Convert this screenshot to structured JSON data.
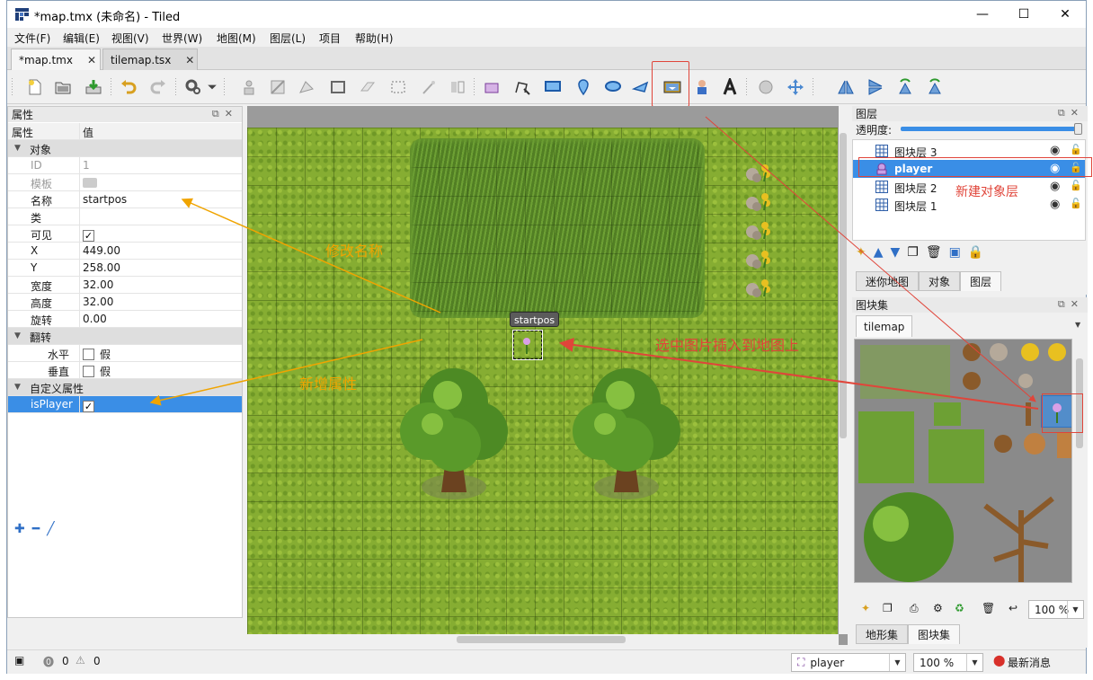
{
  "window": {
    "title": "*map.tmx (未命名) - Tiled",
    "controls": {
      "minimize": "—",
      "maximize": "☐",
      "close": "✕"
    }
  },
  "menu": [
    "文件(F)",
    "编辑(E)",
    "视图(V)",
    "世界(W)",
    "地图(M)",
    "图层(L)",
    "项目",
    "帮助(H)"
  ],
  "doc_tabs": [
    {
      "label": "*map.tmx",
      "active": true
    },
    {
      "label": "tilemap.tsx",
      "active": false
    }
  ],
  "properties": {
    "panel_title": "属性",
    "col_key": "属性",
    "col_value": "值",
    "rows": [
      {
        "kind": "group",
        "key": "对象"
      },
      {
        "kind": "prop",
        "key": "ID",
        "value": "1",
        "dim": true
      },
      {
        "kind": "prop",
        "key": "模板",
        "value": "",
        "dim": true
      },
      {
        "kind": "prop",
        "key": "名称",
        "value": "startpos"
      },
      {
        "kind": "prop",
        "key": "类",
        "value": ""
      },
      {
        "kind": "check",
        "key": "可见",
        "checked": true
      },
      {
        "kind": "prop",
        "key": "X",
        "value": "449.00"
      },
      {
        "kind": "prop",
        "key": "Y",
        "value": "258.00"
      },
      {
        "kind": "prop",
        "key": "宽度",
        "value": "32.00"
      },
      {
        "kind": "prop",
        "key": "高度",
        "value": "32.00"
      },
      {
        "kind": "prop",
        "key": "旋转",
        "value": "0.00"
      },
      {
        "kind": "group",
        "key": "翻转"
      },
      {
        "kind": "checklabel",
        "key": "水平",
        "value": "假",
        "checked": false
      },
      {
        "kind": "checklabel",
        "key": "垂直",
        "value": "假",
        "checked": false
      },
      {
        "kind": "group",
        "key": "自定义属性"
      },
      {
        "kind": "check",
        "key": "isPlayer",
        "checked": true,
        "selected": true
      }
    ]
  },
  "map": {
    "object_label": "startpos"
  },
  "annotations": {
    "rename": "修改名称",
    "add_prop": "新增属性",
    "insert_image": "选中图片插入到地图上",
    "new_layer": "新建对象层"
  },
  "layers": {
    "panel_title": "图层",
    "opacity_label": "透明度:",
    "opacity": 1.0,
    "items": [
      {
        "name": "图块层 3",
        "type": "tile"
      },
      {
        "name": "player",
        "type": "object",
        "selected": true
      },
      {
        "name": "图块层 2",
        "type": "tile"
      },
      {
        "name": "图块层 1",
        "type": "tile"
      }
    ],
    "tabs": [
      "迷你地图",
      "对象",
      "图层"
    ],
    "active_tab": "图层"
  },
  "tilesets": {
    "panel_title": "图块集",
    "tab": "tilemap",
    "zoom": "100 %",
    "bottom_tabs": [
      "地形集",
      "图块集"
    ],
    "active_bottom_tab": "图块集"
  },
  "status": {
    "errors": "0",
    "warnings": "0",
    "layer_select": "player",
    "zoom": "100 %",
    "news": "最新消息"
  },
  "colors": {
    "accent": "#3a8ee6",
    "annotation_orange": "#f0a400",
    "annotation_red": "#e0453a",
    "grass": "#86ad32"
  }
}
